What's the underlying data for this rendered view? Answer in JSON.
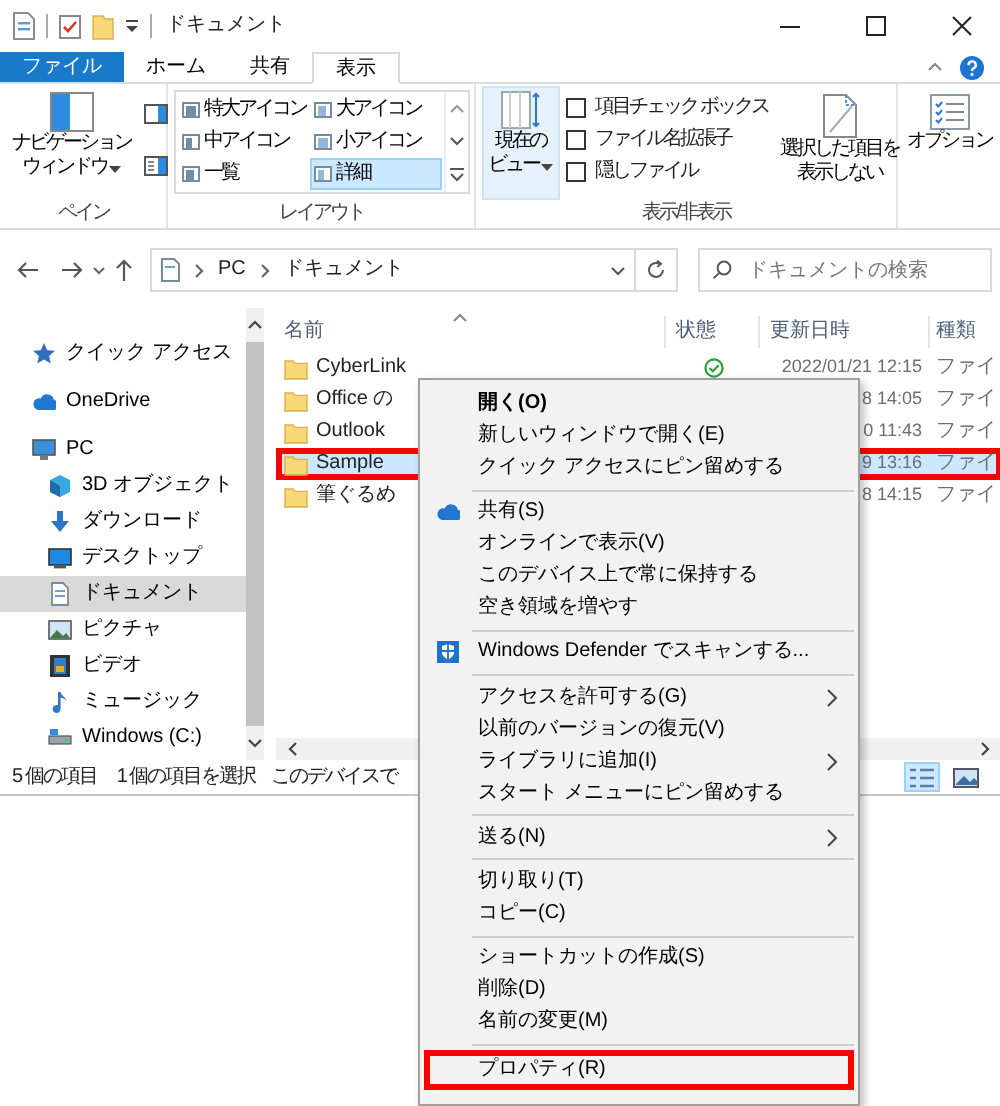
{
  "window": {
    "title": "ドキュメント"
  },
  "ribbon": {
    "tabs": [
      {
        "label": "ファイル",
        "kind": "file",
        "selected": false
      },
      {
        "label": "ホーム",
        "kind": "tab",
        "selected": false
      },
      {
        "label": "共有",
        "kind": "tab",
        "selected": false
      },
      {
        "label": "表示",
        "kind": "tab",
        "selected": true
      }
    ],
    "pane_group": {
      "label": "ペイン",
      "navigation_pane_lines": [
        "ナビゲーション",
        "ウィンドウ"
      ]
    },
    "layout_group": {
      "label": "レイアウト",
      "options": [
        {
          "label": "特大アイコン",
          "selected": false
        },
        {
          "label": "大アイコン",
          "selected": false
        },
        {
          "label": "中アイコン",
          "selected": false
        },
        {
          "label": "小アイコン",
          "selected": false
        },
        {
          "label": "一覧",
          "selected": false
        },
        {
          "label": "詳細",
          "selected": true
        }
      ]
    },
    "show_hide_group": {
      "label": "表示/非表示",
      "current_view_lines": [
        "現在の",
        "ビュー"
      ],
      "checkboxes": [
        {
          "label": "項目チェック ボックス",
          "checked": false
        },
        {
          "label": "ファイル名拡張子",
          "checked": false
        },
        {
          "label": "隠しファイル",
          "checked": false
        }
      ],
      "hide_selected_lines": [
        "選択した項目を",
        "表示しない"
      ]
    },
    "options": {
      "label": "オプション"
    }
  },
  "address": {
    "path": [
      "PC",
      "ドキュメント"
    ],
    "search_placeholder": "ドキュメントの検索"
  },
  "nav": {
    "items": [
      {
        "label": "クイック アクセス",
        "kind": "star",
        "selected": false
      },
      {
        "label": "OneDrive",
        "kind": "cloud",
        "selected": false
      },
      {
        "label": "PC",
        "kind": "monitor",
        "selected": false,
        "children": [
          {
            "label": "3D オブジェクト",
            "kind": "cube",
            "selected": false
          },
          {
            "label": "ダウンロード",
            "kind": "download",
            "selected": false
          },
          {
            "label": "デスクトップ",
            "kind": "desktop",
            "selected": false
          },
          {
            "label": "ドキュメント",
            "kind": "document",
            "selected": true
          },
          {
            "label": "ピクチャ",
            "kind": "picture",
            "selected": false
          },
          {
            "label": "ビデオ",
            "kind": "film",
            "selected": false
          },
          {
            "label": "ミュージック",
            "kind": "note",
            "selected": false
          },
          {
            "label": "Windows (C:)",
            "kind": "drive",
            "selected": false
          }
        ]
      }
    ]
  },
  "files": {
    "columns": [
      "名前",
      "状態",
      "更新日時",
      "種類"
    ],
    "rows": [
      {
        "name": "CyberLink",
        "synced": true,
        "modified": "2022/01/21 12:15",
        "type": "ファイ",
        "selected": false,
        "callout": false
      },
      {
        "name": "Office の",
        "modified": "8 14:05",
        "type": "ファイ",
        "selected": false,
        "callout": false
      },
      {
        "name": "Outlook",
        "modified": "0 11:43",
        "type": "ファイ",
        "selected": false,
        "callout": false
      },
      {
        "name": "Sample",
        "modified": "9 13:16",
        "type": "ファイ",
        "selected": true,
        "callout": true
      },
      {
        "name": "筆ぐるめ",
        "modified": "8 14:15",
        "type": "ファイ",
        "selected": false,
        "callout": false
      }
    ]
  },
  "status_bar": {
    "item_count": "5 個の項目",
    "selection": "1 個の項目を選択",
    "sync_status": "このデバイスで"
  },
  "context_menu": {
    "items": [
      {
        "kind": "item",
        "label": "開く(O)",
        "bold": true
      },
      {
        "kind": "item",
        "label": "新しいウィンドウで開く(E)"
      },
      {
        "kind": "item",
        "label": "クイック アクセスにピン留めする"
      },
      {
        "kind": "separator"
      },
      {
        "kind": "cloud",
        "label": "共有(S)"
      },
      {
        "kind": "item",
        "label": "オンラインで表示(V)"
      },
      {
        "kind": "item",
        "label": "このデバイス上で常に保持する"
      },
      {
        "kind": "item",
        "label": "空き領域を増やす"
      },
      {
        "kind": "separator"
      },
      {
        "kind": "shield",
        "label": "Windows Defender でスキャンする..."
      },
      {
        "kind": "separator"
      },
      {
        "kind": "item",
        "label": "アクセスを許可する(G)",
        "submenu": true
      },
      {
        "kind": "item",
        "label": "以前のバージョンの復元(V)"
      },
      {
        "kind": "item",
        "label": "ライブラリに追加(I)",
        "submenu": true
      },
      {
        "kind": "item",
        "label": "スタート メニューにピン留めする"
      },
      {
        "kind": "separator"
      },
      {
        "kind": "item",
        "label": "送る(N)",
        "submenu": true
      },
      {
        "kind": "separator"
      },
      {
        "kind": "item",
        "label": "切り取り(T)"
      },
      {
        "kind": "item",
        "label": "コピー(C)"
      },
      {
        "kind": "separator"
      },
      {
        "kind": "item",
        "label": "ショートカットの作成(S)"
      },
      {
        "kind": "item",
        "label": "削除(D)"
      },
      {
        "kind": "item",
        "label": "名前の変更(M)"
      },
      {
        "kind": "separator"
      },
      {
        "kind": "item",
        "label": "プロパティ(R)",
        "callout": true
      }
    ]
  }
}
